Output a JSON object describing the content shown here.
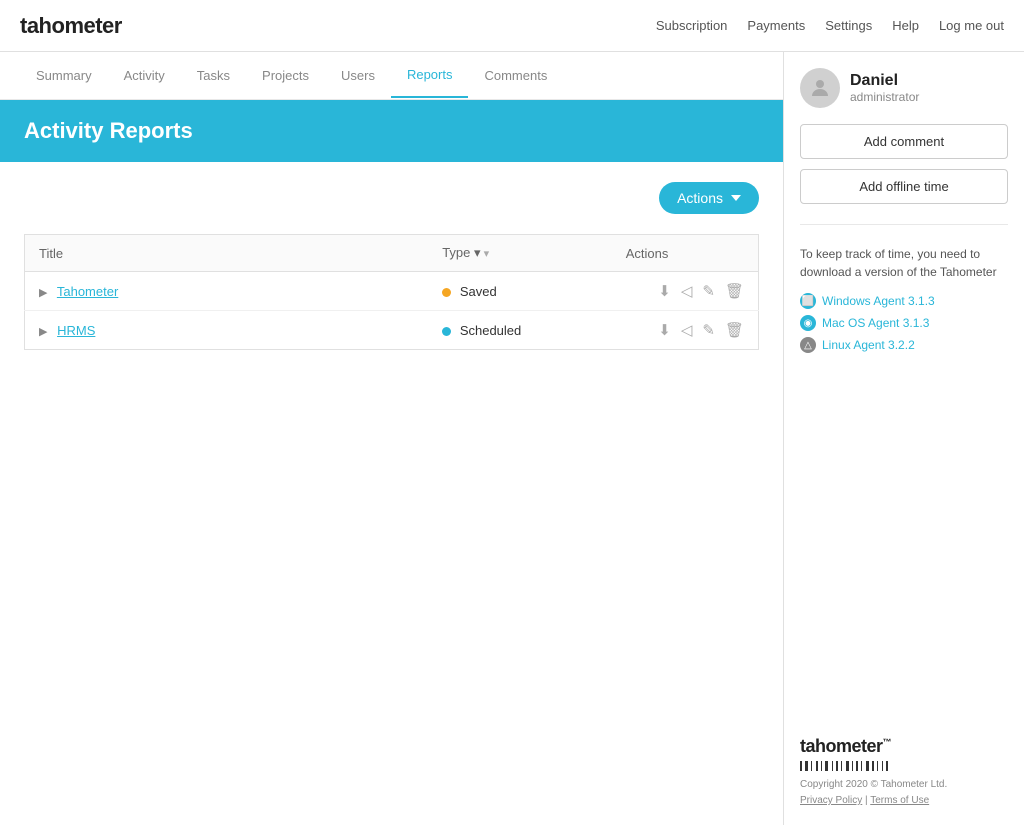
{
  "app": {
    "logo": "tahometer",
    "top_nav": {
      "links": [
        {
          "label": "Subscription",
          "href": "#"
        },
        {
          "label": "Payments",
          "href": "#"
        },
        {
          "label": "Settings",
          "href": "#"
        },
        {
          "label": "Help",
          "href": "#"
        },
        {
          "label": "Log me out",
          "href": "#"
        }
      ]
    }
  },
  "secondary_nav": {
    "items": [
      {
        "label": "Summary",
        "active": false
      },
      {
        "label": "Activity",
        "active": false
      },
      {
        "label": "Tasks",
        "active": false
      },
      {
        "label": "Projects",
        "active": false
      },
      {
        "label": "Users",
        "active": false
      },
      {
        "label": "Reports",
        "active": true
      },
      {
        "label": "Comments",
        "active": false
      }
    ]
  },
  "page": {
    "title": "Activity Reports",
    "actions_button": "Actions"
  },
  "table": {
    "columns": [
      {
        "label": "Title",
        "sortable": false
      },
      {
        "label": "Type",
        "sortable": true
      },
      {
        "label": "Actions",
        "sortable": false
      }
    ],
    "rows": [
      {
        "id": 1,
        "title": "Tahometer",
        "type": "Saved",
        "type_color": "yellow"
      },
      {
        "id": 2,
        "title": "HRMS",
        "type": "Scheduled",
        "type_color": "blue"
      }
    ]
  },
  "sidebar": {
    "user": {
      "name": "Daniel",
      "role": "administrator"
    },
    "buttons": [
      {
        "label": "Add comment"
      },
      {
        "label": "Add offline time"
      }
    ],
    "info_text": "To keep track of time, you need to download a version of the Tahometer",
    "download_links": [
      {
        "label": "Windows Agent 3.1.3",
        "icon_color": "blue"
      },
      {
        "label": "Mac OS Agent 3.1.3",
        "icon_color": "blue"
      },
      {
        "label": "Linux Agent 3.2.2",
        "icon_color": "gray"
      }
    ],
    "footer": {
      "logo": "tahometer",
      "trademark": "™",
      "copyright": "Copyright 2020 © Tahometer Ltd.",
      "privacy": "Privacy Policy",
      "separator": " | ",
      "terms": "Terms of Use"
    }
  }
}
